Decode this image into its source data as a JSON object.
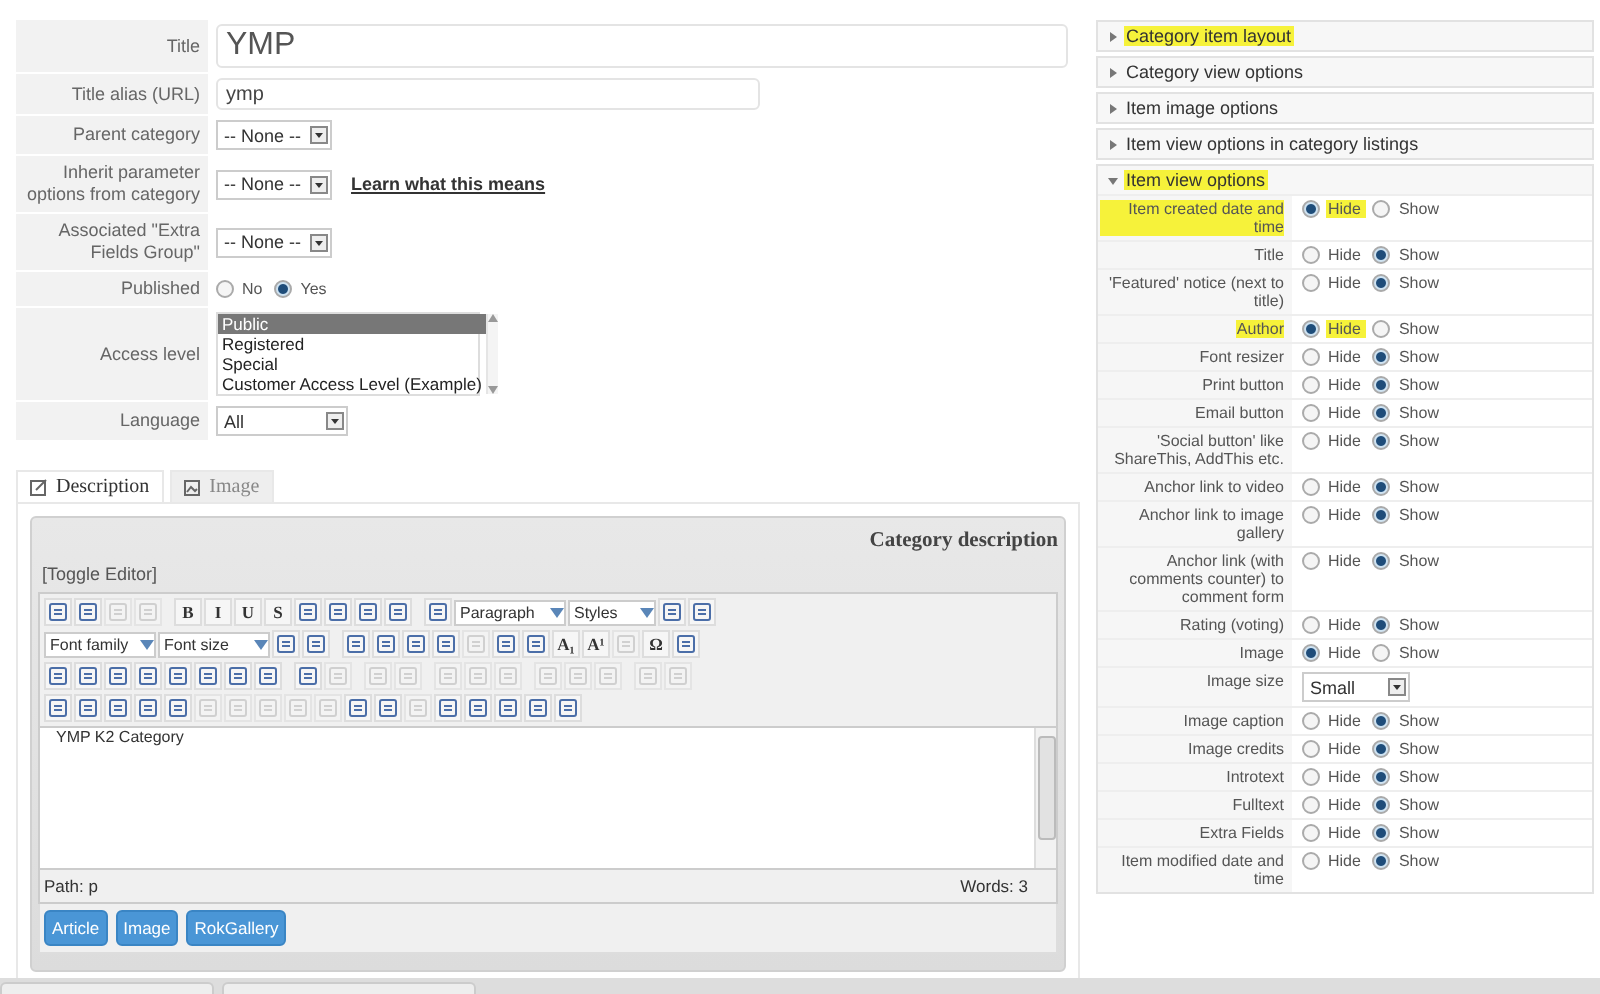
{
  "form": {
    "rows": [
      {
        "label": "Title",
        "kind": "title",
        "value": "YMP"
      },
      {
        "label": "Title alias (URL)",
        "kind": "text",
        "value": "ymp"
      },
      {
        "label": "Parent category",
        "kind": "select",
        "value": "-- None --"
      },
      {
        "label": "Inherit parameter options from category",
        "kind": "select",
        "value": "-- None --",
        "link": "Learn what this means"
      },
      {
        "label": "Associated \"Extra Fields Group\"",
        "kind": "select",
        "value": "-- None --"
      },
      {
        "label": "Published",
        "kind": "radio",
        "options": [
          {
            "label": "No",
            "selected": false
          },
          {
            "label": "Yes",
            "selected": true
          }
        ]
      },
      {
        "label": "Access level",
        "kind": "list",
        "items": [
          {
            "label": "Public",
            "selected": true
          },
          {
            "label": "Registered",
            "selected": false
          },
          {
            "label": "Special",
            "selected": false
          },
          {
            "label": "Customer Access Level (Example)",
            "selected": false
          }
        ]
      },
      {
        "label": "Language",
        "kind": "select",
        "value": "All"
      }
    ]
  },
  "tabs": [
    {
      "label": "Description",
      "selected": true
    },
    {
      "label": "Image",
      "selected": false
    }
  ],
  "editor": {
    "title": "Category description",
    "toggle": "[Toggle Editor]",
    "toolbar": [
      [
        {
          "kind": "icon"
        },
        {
          "kind": "icon"
        },
        {
          "kind": "icon",
          "disabled": true
        },
        {
          "kind": "icon",
          "disabled": true
        },
        {
          "kind": "sep"
        },
        {
          "kind": "glyph",
          "text": "B"
        },
        {
          "kind": "glyph",
          "text": "I"
        },
        {
          "kind": "glyph",
          "text": "U"
        },
        {
          "kind": "glyph",
          "text": "S"
        },
        {
          "kind": "icon"
        },
        {
          "kind": "icon"
        },
        {
          "kind": "icon"
        },
        {
          "kind": "icon"
        },
        {
          "kind": "sep"
        },
        {
          "kind": "icon"
        },
        {
          "kind": "select",
          "label": "Paragraph"
        },
        {
          "kind": "select",
          "label": "Styles"
        },
        {
          "kind": "icon"
        },
        {
          "kind": "icon"
        }
      ],
      [
        {
          "kind": "select",
          "label": "Font family"
        },
        {
          "kind": "select",
          "label": "Font size"
        },
        {
          "kind": "icon"
        },
        {
          "kind": "icon"
        },
        {
          "kind": "sep"
        },
        {
          "kind": "icon"
        },
        {
          "kind": "icon"
        },
        {
          "kind": "icon"
        },
        {
          "kind": "icon"
        },
        {
          "kind": "icon",
          "disabled": true
        },
        {
          "kind": "icon"
        },
        {
          "kind": "icon"
        },
        {
          "kind": "glyph",
          "text": "A₁"
        },
        {
          "kind": "glyph",
          "text": "A¹"
        },
        {
          "kind": "icon",
          "disabled": true
        },
        {
          "kind": "glyph",
          "text": "Ω"
        },
        {
          "kind": "icon"
        }
      ],
      [
        {
          "kind": "icon"
        },
        {
          "kind": "icon"
        },
        {
          "kind": "icon"
        },
        {
          "kind": "icon"
        },
        {
          "kind": "icon"
        },
        {
          "kind": "icon"
        },
        {
          "kind": "icon"
        },
        {
          "kind": "icon"
        },
        {
          "kind": "sep"
        },
        {
          "kind": "icon"
        },
        {
          "kind": "icon",
          "disabled": true
        },
        {
          "kind": "sep"
        },
        {
          "kind": "icon",
          "disabled": true
        },
        {
          "kind": "icon",
          "disabled": true
        },
        {
          "kind": "sep"
        },
        {
          "kind": "icon",
          "disabled": true
        },
        {
          "kind": "icon",
          "disabled": true
        },
        {
          "kind": "icon",
          "disabled": true
        },
        {
          "kind": "sep"
        },
        {
          "kind": "icon",
          "disabled": true
        },
        {
          "kind": "icon",
          "disabled": true
        },
        {
          "kind": "icon",
          "disabled": true
        },
        {
          "kind": "sep"
        },
        {
          "kind": "icon",
          "disabled": true
        },
        {
          "kind": "icon",
          "disabled": true
        }
      ],
      [
        {
          "kind": "icon"
        },
        {
          "kind": "icon"
        },
        {
          "kind": "icon"
        },
        {
          "kind": "icon"
        },
        {
          "kind": "icon"
        },
        {
          "kind": "icon",
          "disabled": true
        },
        {
          "kind": "icon",
          "disabled": true
        },
        {
          "kind": "icon",
          "disabled": true
        },
        {
          "kind": "icon",
          "disabled": true
        },
        {
          "kind": "icon",
          "disabled": true
        },
        {
          "kind": "icon"
        },
        {
          "kind": "icon"
        },
        {
          "kind": "icon",
          "disabled": true
        },
        {
          "kind": "icon"
        },
        {
          "kind": "icon"
        },
        {
          "kind": "icon"
        },
        {
          "kind": "icon"
        },
        {
          "kind": "icon"
        }
      ]
    ],
    "content": "YMP K2 Category",
    "path": "Path:  p",
    "words": "Words: 3",
    "buttons": [
      "Article",
      "Image",
      "RokGallery"
    ]
  },
  "sections": [
    {
      "label": "Category item layout",
      "expanded": false,
      "highlighted": true
    },
    {
      "label": "Category view options",
      "expanded": false,
      "highlighted": false
    },
    {
      "label": "Item image options",
      "expanded": false,
      "highlighted": false
    },
    {
      "label": "Item view options in category listings",
      "expanded": false,
      "highlighted": false
    },
    {
      "label": "Item view options",
      "expanded": true,
      "highlighted": true,
      "rows": [
        {
          "label": "Item created date and time",
          "kind": "radio",
          "highlighted": true,
          "options": [
            {
              "label": "Hide",
              "selected": true
            },
            {
              "label": "Show",
              "selected": false
            }
          ]
        },
        {
          "label": "Title",
          "kind": "radio",
          "highlighted": false,
          "options": [
            {
              "label": "Hide",
              "selected": false
            },
            {
              "label": "Show",
              "selected": true
            }
          ]
        },
        {
          "label": "'Featured' notice (next to title)",
          "kind": "radio",
          "highlighted": false,
          "options": [
            {
              "label": "Hide",
              "selected": false
            },
            {
              "label": "Show",
              "selected": true
            }
          ]
        },
        {
          "label": "Author",
          "kind": "radio",
          "highlighted": true,
          "options": [
            {
              "label": "Hide",
              "selected": true
            },
            {
              "label": "Show",
              "selected": false
            }
          ]
        },
        {
          "label": "Font resizer",
          "kind": "radio",
          "highlighted": false,
          "options": [
            {
              "label": "Hide",
              "selected": false
            },
            {
              "label": "Show",
              "selected": true
            }
          ]
        },
        {
          "label": "Print button",
          "kind": "radio",
          "highlighted": false,
          "options": [
            {
              "label": "Hide",
              "selected": false
            },
            {
              "label": "Show",
              "selected": true
            }
          ]
        },
        {
          "label": "Email button",
          "kind": "radio",
          "highlighted": false,
          "options": [
            {
              "label": "Hide",
              "selected": false
            },
            {
              "label": "Show",
              "selected": true
            }
          ]
        },
        {
          "label": "'Social button' like ShareThis, AddThis etc.",
          "kind": "radio",
          "highlighted": false,
          "options": [
            {
              "label": "Hide",
              "selected": false
            },
            {
              "label": "Show",
              "selected": true
            }
          ]
        },
        {
          "label": "Anchor link to video",
          "kind": "radio",
          "highlighted": false,
          "options": [
            {
              "label": "Hide",
              "selected": false
            },
            {
              "label": "Show",
              "selected": true
            }
          ]
        },
        {
          "label": "Anchor link to image gallery",
          "kind": "radio",
          "highlighted": false,
          "options": [
            {
              "label": "Hide",
              "selected": false
            },
            {
              "label": "Show",
              "selected": true
            }
          ]
        },
        {
          "label": "Anchor link (with comments counter) to comment form",
          "kind": "radio",
          "highlighted": false,
          "options": [
            {
              "label": "Hide",
              "selected": false
            },
            {
              "label": "Show",
              "selected": true
            }
          ]
        },
        {
          "label": "Rating (voting)",
          "kind": "radio",
          "highlighted": false,
          "options": [
            {
              "label": "Hide",
              "selected": false
            },
            {
              "label": "Show",
              "selected": true
            }
          ]
        },
        {
          "label": "Image",
          "kind": "radio",
          "highlighted": false,
          "options": [
            {
              "label": "Hide",
              "selected": true
            },
            {
              "label": "Show",
              "selected": false
            }
          ]
        },
        {
          "label": "Image size",
          "kind": "select",
          "highlighted": false,
          "value": "Small"
        },
        {
          "label": "Image caption",
          "kind": "radio",
          "highlighted": false,
          "options": [
            {
              "label": "Hide",
              "selected": false
            },
            {
              "label": "Show",
              "selected": true
            }
          ]
        },
        {
          "label": "Image credits",
          "kind": "radio",
          "highlighted": false,
          "options": [
            {
              "label": "Hide",
              "selected": false
            },
            {
              "label": "Show",
              "selected": true
            }
          ]
        },
        {
          "label": "Introtext",
          "kind": "radio",
          "highlighted": false,
          "options": [
            {
              "label": "Hide",
              "selected": false
            },
            {
              "label": "Show",
              "selected": true
            }
          ]
        },
        {
          "label": "Fulltext",
          "kind": "radio",
          "highlighted": false,
          "options": [
            {
              "label": "Hide",
              "selected": false
            },
            {
              "label": "Show",
              "selected": true
            }
          ]
        },
        {
          "label": "Extra Fields",
          "kind": "radio",
          "highlighted": false,
          "options": [
            {
              "label": "Hide",
              "selected": false
            },
            {
              "label": "Show",
              "selected": true
            }
          ]
        },
        {
          "label": "Item modified date and time",
          "kind": "radio",
          "highlighted": false,
          "options": [
            {
              "label": "Hide",
              "selected": false
            },
            {
              "label": "Show",
              "selected": true
            }
          ]
        }
      ]
    }
  ]
}
